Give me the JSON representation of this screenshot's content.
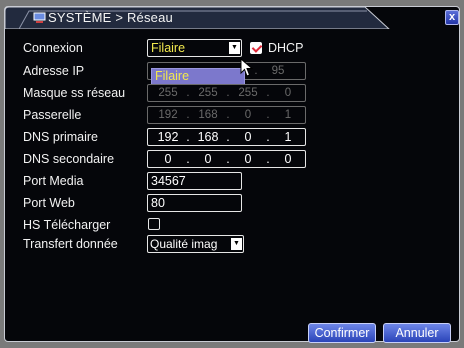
{
  "window": {
    "title": "SYSTÈME > Réseau",
    "close_glyph": "x"
  },
  "form": {
    "connection": {
      "label": "Connexion",
      "value": "Filaire",
      "dropdown_option": "Filaire",
      "dhcp_label": "DHCP",
      "dhcp_checked": true
    },
    "ip_address": {
      "label": "Adresse IP",
      "octet4": "95"
    },
    "subnet_mask": {
      "label": "Masque ss réseau",
      "octets": [
        "255",
        "255",
        "255",
        "0"
      ]
    },
    "gateway": {
      "label": "Passerelle",
      "octets": [
        "192",
        "168",
        "0",
        "1"
      ]
    },
    "primary_dns": {
      "label": "DNS primaire",
      "octets": [
        "192",
        "168",
        "0",
        "1"
      ]
    },
    "secondary_dns": {
      "label": "DNS secondaire",
      "octets": [
        "0",
        "0",
        "0",
        "0"
      ]
    },
    "media_port": {
      "label": "Port Media",
      "value": "34567"
    },
    "web_port": {
      "label": "Port Web",
      "value": "80"
    },
    "hs_download": {
      "label": "HS Télécharger",
      "checked": false
    },
    "data_transfer": {
      "label": "Transfert donnée",
      "value": "Qualité imag"
    }
  },
  "buttons": {
    "confirm": "Confirmer",
    "cancel": "Annuler"
  },
  "colors": {
    "background": "#05060a",
    "border": "#c9ccd4",
    "selected_text": "#f2e94e",
    "dropdown_highlight": "#7c78cc",
    "button": "#3a55cc"
  },
  "icons": {
    "title_icon": "network-icon",
    "dropdown_arrow": "chevron-down-icon",
    "cursor": "mouse-pointer-icon",
    "close": "close-icon"
  }
}
